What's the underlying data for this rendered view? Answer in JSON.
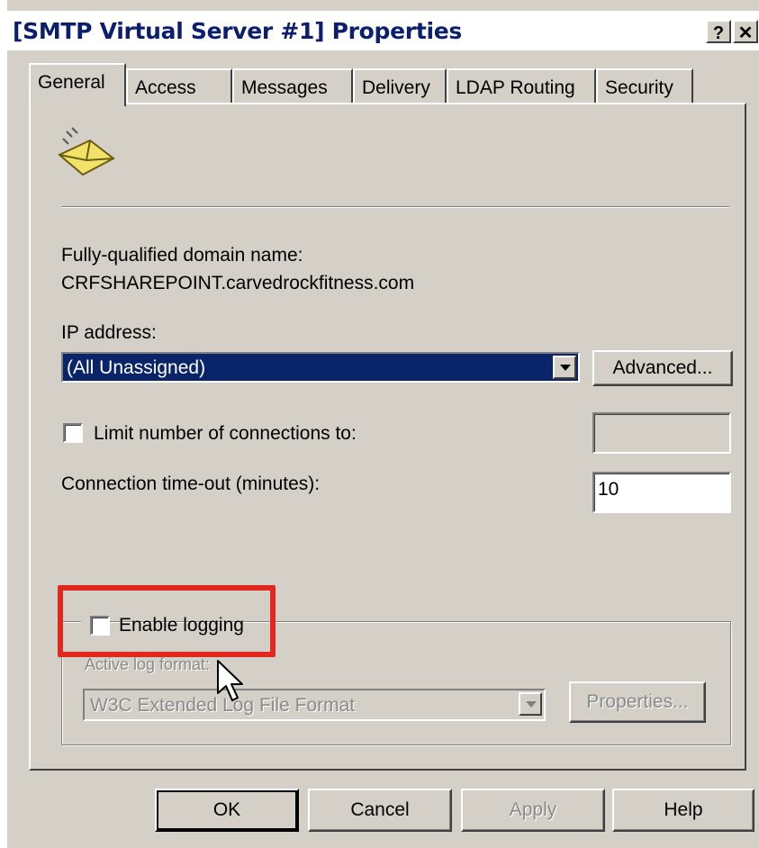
{
  "window": {
    "title": "[SMTP Virtual Server #1] Properties",
    "help_glyph": "?",
    "close_glyph": "✕"
  },
  "tabs": [
    {
      "label": "General",
      "active": true
    },
    {
      "label": "Access",
      "active": false
    },
    {
      "label": "Messages",
      "active": false
    },
    {
      "label": "Delivery",
      "active": false
    },
    {
      "label": "LDAP Routing",
      "active": false
    },
    {
      "label": "Security",
      "active": false
    }
  ],
  "general": {
    "icon": "envelope-icon",
    "fqdn_label": "Fully-qualified domain name:",
    "fqdn_value": "CRFSHAREPOINT.carvedrockfitness.com",
    "ip_label": "IP address:",
    "ip_value": "(All Unassigned)",
    "advanced_button": "Advanced...",
    "limit_connections_label": "Limit number of connections to:",
    "limit_connections_checked": false,
    "limit_connections_value": "",
    "timeout_label": "Connection time-out (minutes):",
    "timeout_value": "10",
    "enable_logging_label": "Enable logging",
    "enable_logging_checked": false,
    "log_format_label": "Active log format:",
    "log_format_value": "W3C Extended Log File Format",
    "properties_button": "Properties..."
  },
  "footer": {
    "ok": "OK",
    "cancel": "Cancel",
    "apply": "Apply",
    "help": "Help"
  },
  "colors": {
    "highlight_box": "#e0281e",
    "selection": "#0a246a",
    "dialog_face": "#d4d0c8"
  }
}
